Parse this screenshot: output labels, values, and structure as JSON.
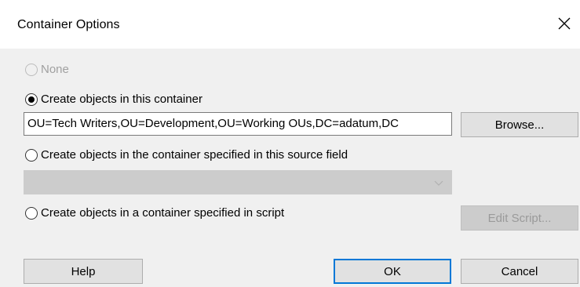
{
  "dialog": {
    "title": "Container Options",
    "close_icon": "close-icon"
  },
  "options": [
    {
      "label": "None",
      "checked": false,
      "enabled": false
    },
    {
      "label": "Create objects in this container",
      "checked": true,
      "enabled": true
    },
    {
      "label": "Create objects in the container specified in this source field",
      "checked": false,
      "enabled": true
    },
    {
      "label": "Create objects in a container specified in script",
      "checked": false,
      "enabled": true
    }
  ],
  "container_path": {
    "value": "OU=Tech Writers,OU=Development,OU=Working OUs,DC=adatum,DC"
  },
  "source_field_select": {
    "selected": "",
    "enabled": false,
    "icon": "chevron-down-icon"
  },
  "buttons": {
    "browse": "Browse...",
    "edit_script": "Edit Script...",
    "help": "Help",
    "ok": "OK",
    "cancel": "Cancel"
  },
  "colors": {
    "dialog_bg": "#f0f0f0",
    "titlebar_bg": "#ffffff",
    "button_bg": "#e1e1e1",
    "default_button_border": "#0078d7",
    "disabled_bg": "#cccccc"
  }
}
